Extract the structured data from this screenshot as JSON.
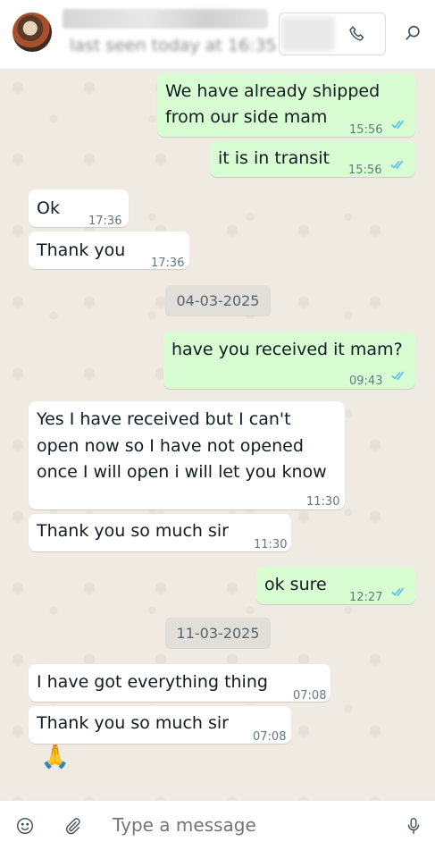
{
  "header": {
    "last_seen": "last seen today at 16:35"
  },
  "messages": [
    {
      "dir": "out",
      "lines": [
        "We have already shipped",
        "from our side mam"
      ],
      "time": "15:56"
    },
    {
      "dir": "out",
      "lines": [
        "it is in transit"
      ],
      "time": "15:56"
    },
    {
      "dir": "in",
      "lines": [
        "Ok"
      ],
      "time": "17:36"
    },
    {
      "dir": "in",
      "lines": [
        "Thank you"
      ],
      "time": "17:36"
    },
    {
      "dir": "date",
      "label": "04-03-2025"
    },
    {
      "dir": "out",
      "lines": [
        "have you received it mam?"
      ],
      "time": "09:43"
    },
    {
      "dir": "in",
      "lines": [
        "Yes I have received but I can't",
        "open now so I have not opened",
        "once I will open i will let you know"
      ],
      "time": "11:30"
    },
    {
      "dir": "in",
      "lines": [
        "Thank you so much sir"
      ],
      "time": "11:30"
    },
    {
      "dir": "out",
      "lines": [
        "ok sure"
      ],
      "time": "12:27"
    },
    {
      "dir": "date",
      "label": "11-03-2025"
    },
    {
      "dir": "in",
      "lines": [
        "I have got everything thing"
      ],
      "time": "07:08"
    },
    {
      "dir": "in",
      "lines": [
        "Thank you so much sir"
      ],
      "time": "07:08"
    },
    {
      "dir": "emoji",
      "glyph": "🙏"
    }
  ],
  "composer": {
    "placeholder": "Type a message"
  },
  "icons": {
    "call": "phone-icon",
    "search": "search-icon",
    "emoji": "smiley-icon",
    "attach": "paperclip-icon",
    "mic": "microphone-icon"
  },
  "colors": {
    "outgoing": "#d9fdd3",
    "incoming": "#ffffff",
    "chat_bg": "#efeae2",
    "read_ticks": "#53bdeb"
  }
}
